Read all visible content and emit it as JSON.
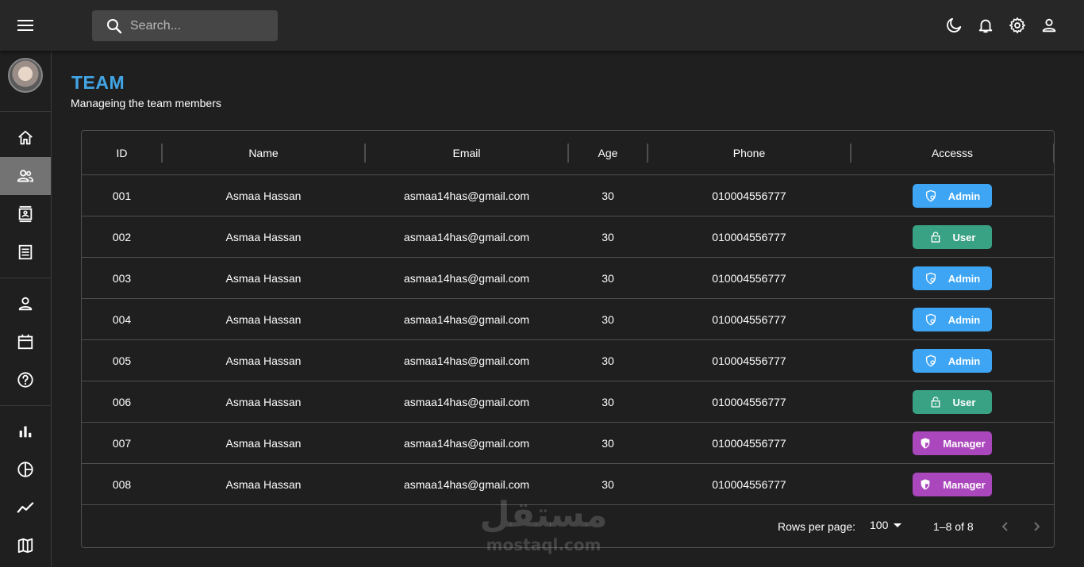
{
  "search": {
    "placeholder": "Search..."
  },
  "header": {
    "icons": [
      "moon-icon",
      "bell-icon",
      "gear-icon",
      "person-icon"
    ]
  },
  "sidebar": {
    "items": [
      {
        "name": "home",
        "icon": "home-icon",
        "active": false
      },
      {
        "name": "team",
        "icon": "people-icon",
        "active": true
      },
      {
        "name": "contacts",
        "icon": "contacts-icon",
        "active": false
      },
      {
        "name": "invoices",
        "icon": "receipt-icon",
        "active": false
      },
      {
        "name": "profile",
        "icon": "person-icon",
        "active": false
      },
      {
        "name": "calendar",
        "icon": "calendar-icon",
        "active": false
      },
      {
        "name": "faq",
        "icon": "help-icon",
        "active": false
      },
      {
        "name": "bar",
        "icon": "bar-chart-icon",
        "active": false
      },
      {
        "name": "pie",
        "icon": "pie-chart-icon",
        "active": false
      },
      {
        "name": "line",
        "icon": "line-chart-icon",
        "active": false
      },
      {
        "name": "geo",
        "icon": "map-icon",
        "active": false
      }
    ]
  },
  "page": {
    "title": "TEAM",
    "subtitle": "Manageing the team members"
  },
  "table": {
    "columns": [
      "ID",
      "Name",
      "Email",
      "Age",
      "Phone",
      "Accesss"
    ],
    "rows": [
      {
        "id": "001",
        "name": "Asmaa Hassan",
        "email": "asmaa14has@gmail.com",
        "age": "30",
        "phone": "010004556777",
        "access": "Admin"
      },
      {
        "id": "002",
        "name": "Asmaa Hassan",
        "email": "asmaa14has@gmail.com",
        "age": "30",
        "phone": "010004556777",
        "access": "User"
      },
      {
        "id": "003",
        "name": "Asmaa Hassan",
        "email": "asmaa14has@gmail.com",
        "age": "30",
        "phone": "010004556777",
        "access": "Admin"
      },
      {
        "id": "004",
        "name": "Asmaa Hassan",
        "email": "asmaa14has@gmail.com",
        "age": "30",
        "phone": "010004556777",
        "access": "Admin"
      },
      {
        "id": "005",
        "name": "Asmaa Hassan",
        "email": "asmaa14has@gmail.com",
        "age": "30",
        "phone": "010004556777",
        "access": "Admin"
      },
      {
        "id": "006",
        "name": "Asmaa Hassan",
        "email": "asmaa14has@gmail.com",
        "age": "30",
        "phone": "010004556777",
        "access": "User"
      },
      {
        "id": "007",
        "name": "Asmaa Hassan",
        "email": "asmaa14has@gmail.com",
        "age": "30",
        "phone": "010004556777",
        "access": "Manager"
      },
      {
        "id": "008",
        "name": "Asmaa Hassan",
        "email": "asmaa14has@gmail.com",
        "age": "30",
        "phone": "010004556777",
        "access": "Manager"
      }
    ]
  },
  "pagination": {
    "rows_per_page_label": "Rows per page:",
    "rows_per_page": "100",
    "range": "1–8 of 8"
  },
  "colors": {
    "accent": "#42a5e6",
    "admin": "#3da5f4",
    "user": "#3aa284",
    "manager": "#ab47bc"
  },
  "watermark": {
    "arabic": "مستقل",
    "latin": "mostaql.com"
  }
}
